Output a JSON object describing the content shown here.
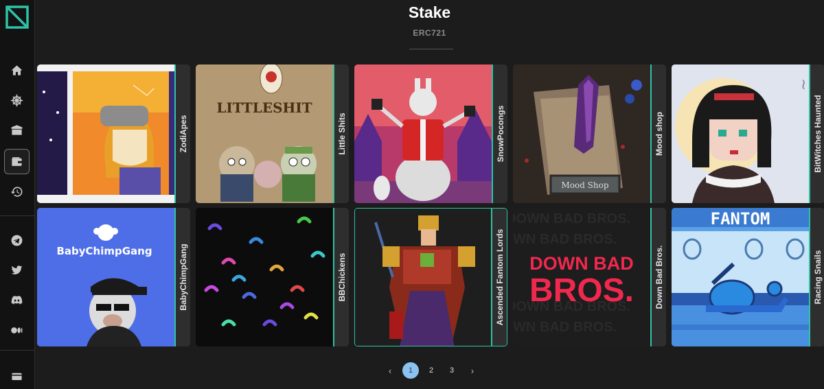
{
  "page": {
    "title": "Stake",
    "subtitle": "ERC721"
  },
  "sidebar": {
    "logo": "nftkey-logo-icon",
    "items": [
      {
        "icon": "home-icon"
      },
      {
        "icon": "ship-wheel-icon"
      },
      {
        "icon": "box-icon"
      },
      {
        "icon": "wallet-icon",
        "active": true
      },
      {
        "icon": "history-icon"
      }
    ],
    "social": [
      {
        "icon": "telegram-icon"
      },
      {
        "icon": "twitter-icon"
      },
      {
        "icon": "discord-icon"
      },
      {
        "icon": "medium-icon"
      }
    ],
    "bottom": {
      "icon": "wallet-icon"
    }
  },
  "collections": [
    {
      "name": "ZodiApes"
    },
    {
      "name": "Little Shits",
      "art_text": "LITTLESHIT"
    },
    {
      "name": "SnowPocongs"
    },
    {
      "name": "Mood shop",
      "art_text": "Mood Shop"
    },
    {
      "name": "BitWitches Haunted"
    },
    {
      "name": "BabyChimpGang",
      "art_text": "BabyChimpGang"
    },
    {
      "name": "BBChickens"
    },
    {
      "name": "Ascended Fantom Lords"
    },
    {
      "name": "Down Bad Bros.",
      "art_text": "DOWN BAD BROS."
    },
    {
      "name": "Racing Snails",
      "art_text": "FANTOM"
    }
  ],
  "pagination": {
    "prev": "‹",
    "next": "›",
    "pages": [
      "1",
      "2",
      "3"
    ],
    "current": "1"
  },
  "colors": {
    "accent": "#2ec4a6",
    "page_active": "#8cc2f0",
    "background": "#1c1c1c"
  }
}
